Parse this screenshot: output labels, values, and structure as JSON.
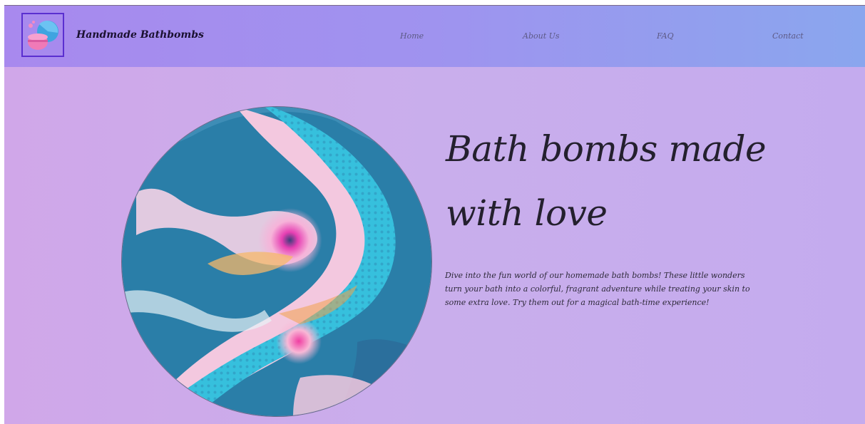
{
  "header": {
    "brand": "Handmade Bathbombs",
    "logo_icon": "bathbomb-logo-icon",
    "nav": [
      {
        "label": "Home"
      },
      {
        "label": "About Us"
      },
      {
        "label": "FAQ"
      },
      {
        "label": "Contact"
      }
    ]
  },
  "hero": {
    "headline_line1": "Bath bombs made",
    "headline_line2": "with love",
    "description": "Dive into the fun world of our homemade bath bombs! These little wonders turn your bath into a colorful, fragrant adventure while treating your skin to some extra love. Try them out for a magical bath-time experience!",
    "image_icon": "bathbomb-swirl-image"
  },
  "colors": {
    "header_start": "#a889ee",
    "header_end": "#8aa6ee",
    "hero_bg": "#c9aeec",
    "logo_border": "#5a2fd0",
    "text_dark": "#24202e"
  }
}
